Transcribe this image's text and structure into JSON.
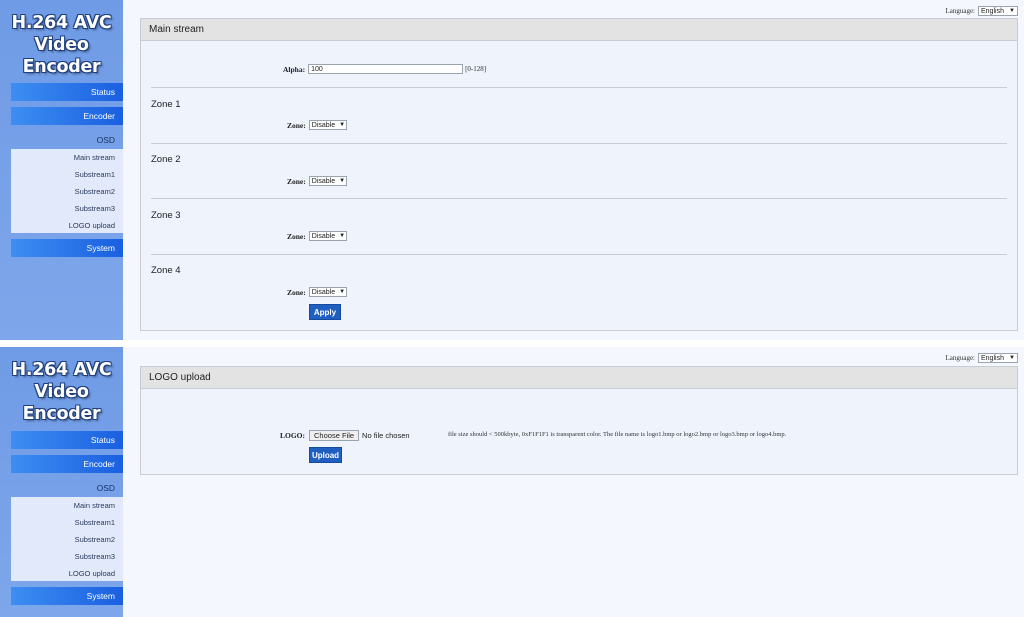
{
  "sidebar": {
    "logo_line1": "H.264 AVC",
    "logo_line2": "Video Encoder",
    "status": "Status",
    "encoder": "Encoder",
    "osd": "OSD",
    "submenu": [
      "Main stream",
      "Substream1",
      "Substream2",
      "Substream3",
      "LOGO upload"
    ],
    "system": "System"
  },
  "language": {
    "label": "Language:",
    "value": "English"
  },
  "main_stream": {
    "title": "Main stream",
    "alpha_label": "Alpha:",
    "alpha_value": "100",
    "alpha_hint": "[0-128]",
    "zones": [
      {
        "title": "Zone 1",
        "label": "Zone:",
        "value": "Disable"
      },
      {
        "title": "Zone 2",
        "label": "Zone:",
        "value": "Disable"
      },
      {
        "title": "Zone 3",
        "label": "Zone:",
        "value": "Disable"
      },
      {
        "title": "Zone 4",
        "label": "Zone:",
        "value": "Disable"
      }
    ],
    "apply": "Apply"
  },
  "logo_upload": {
    "title": "LOGO upload",
    "logo_label": "LOGO:",
    "choose_file": "Choose File",
    "no_file": "No file chosen",
    "note": "file size should < 500kbyte, 0xF1F1F1 is transparent color. The file name is logo1.bmp or logo2.bmp or logo3.bmp or logo4.bmp.",
    "upload": "Upload"
  },
  "colors": {
    "sidebar": "#7ea6ea",
    "nav_button": "#1a5fe0",
    "action_button": "#1f5fc2"
  },
  "icons": {
    "dropdown": "caret-down-icon"
  }
}
